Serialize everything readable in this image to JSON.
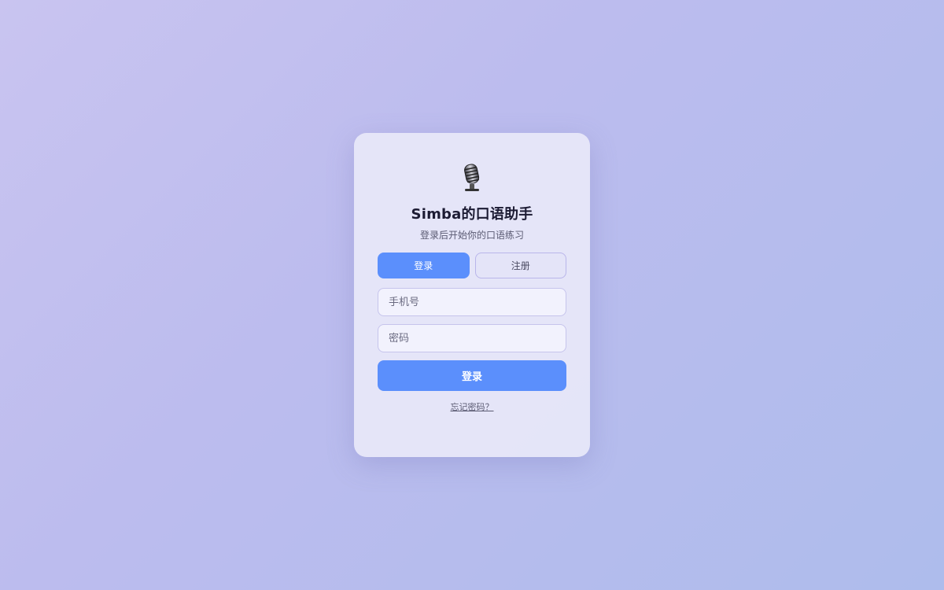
{
  "app": {
    "title": "Simba的口语助手",
    "subtitle": "登录后开始你的口语练习",
    "logo_icon": "microphone-icon"
  },
  "tabs": [
    {
      "label": "登录",
      "active": true
    },
    {
      "label": "注册",
      "active": false
    }
  ],
  "form": {
    "phone_placeholder": "手机号",
    "phone_value": "",
    "password_placeholder": "密码",
    "password_value": "",
    "submit_label": "登录",
    "forgot_label": "忘记密码？"
  },
  "colors": {
    "accent": "#5b8ffc",
    "background_start": "#c9c4f0",
    "background_end": "#aebcec"
  }
}
